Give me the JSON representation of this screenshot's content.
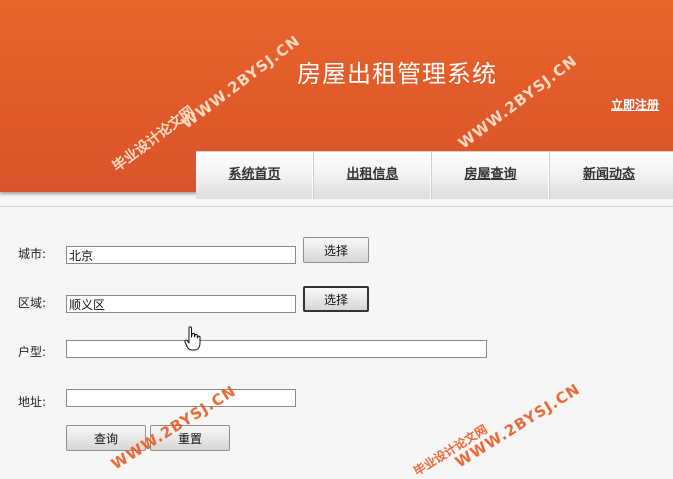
{
  "header": {
    "title": "房屋出租管理系统",
    "register_link": "立即注册"
  },
  "nav": {
    "items": [
      {
        "label": "系统首页"
      },
      {
        "label": "出租信息"
      },
      {
        "label": "房屋查询"
      },
      {
        "label": "新闻动态"
      }
    ]
  },
  "form": {
    "city": {
      "label": "城市:",
      "value": "北京",
      "button": "选择"
    },
    "district": {
      "label": "区域:",
      "value": "顺义区",
      "button": "选择"
    },
    "layout": {
      "label": "户型:",
      "value": ""
    },
    "address": {
      "label": "地址:",
      "value": ""
    },
    "query_button": "查询",
    "reset_button": "重置"
  },
  "watermarks": {
    "site": "WWW.2BYSJ.CN",
    "name": "毕业设计论文网"
  },
  "colors": {
    "header_bg": "#e0592a",
    "watermark": "#eb5a23"
  }
}
